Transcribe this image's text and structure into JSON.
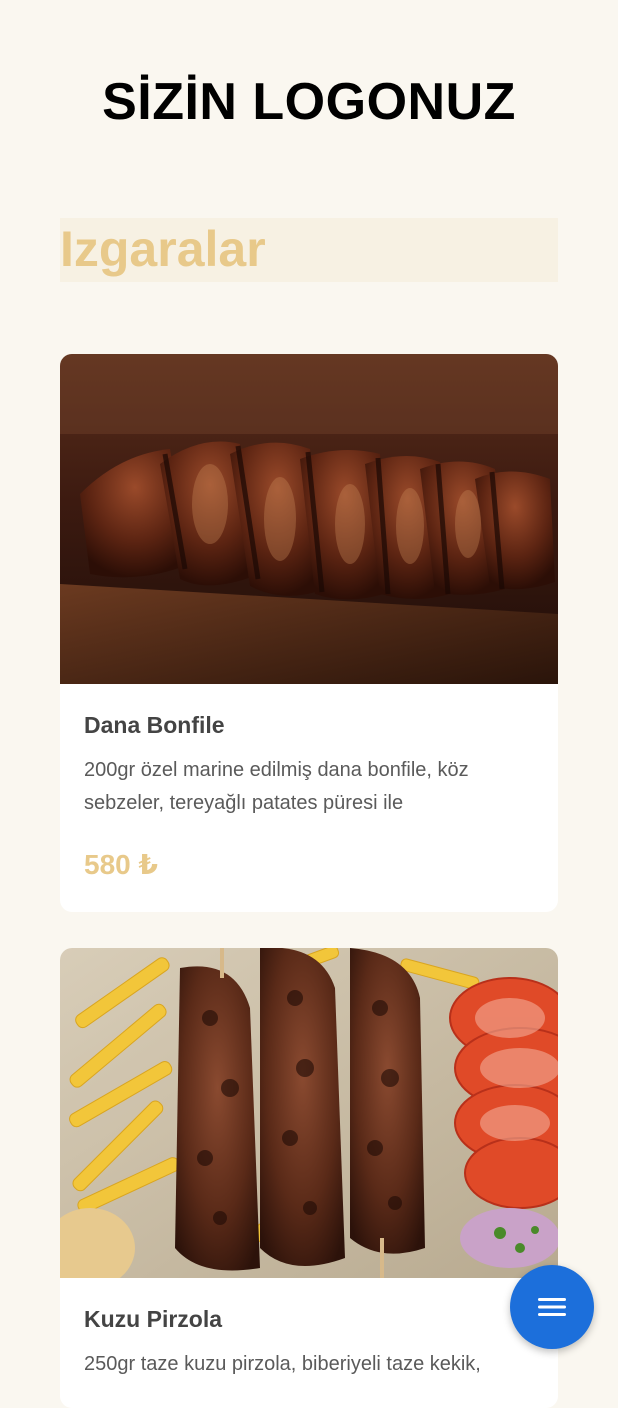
{
  "header": {
    "logo_text": "SİZİN LOGONUZ"
  },
  "section": {
    "title": "Izgaralar"
  },
  "items": [
    {
      "name": "Dana Bonfile",
      "description": "200gr özel marine edilmiş dana bonfile, köz sebzeler, tereyağlı patates püresi ile",
      "price": "580 ₺",
      "image_icon": "steak-photo"
    },
    {
      "name": "Kuzu Pirzola",
      "description": "250gr taze kuzu pirzola, biberiyeli taze kekik,",
      "price": "",
      "image_icon": "kebab-photo"
    }
  ],
  "fab": {
    "icon": "menu-icon"
  },
  "colors": {
    "background": "#faf7f0",
    "accent": "#e8c98a",
    "fab": "#1c6fdb",
    "section_bg": "#f7f1e3"
  }
}
